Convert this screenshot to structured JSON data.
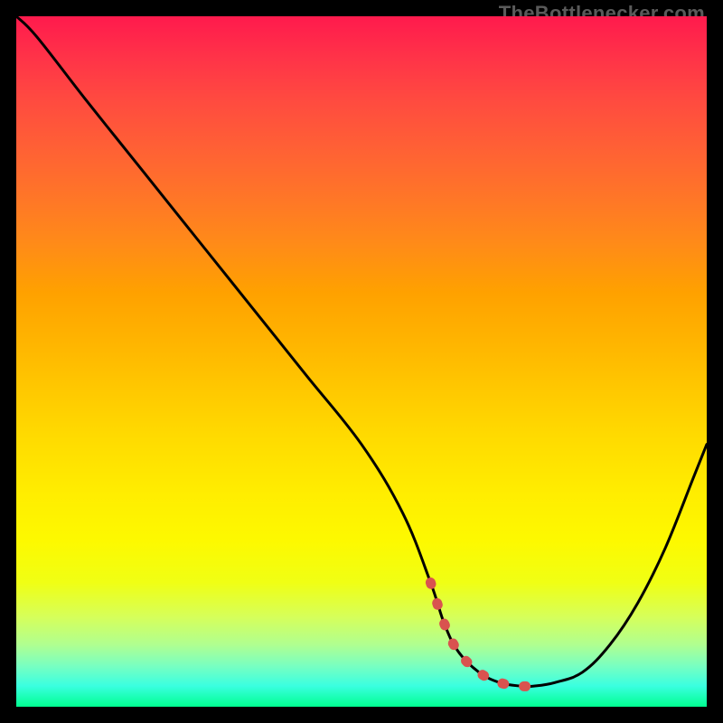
{
  "watermark": "TheBottleneсker.com",
  "chart_data": {
    "type": "line",
    "title": "",
    "xlabel": "",
    "ylabel": "",
    "xlim": [
      0,
      100
    ],
    "ylim": [
      0,
      100
    ],
    "x": [
      0,
      3,
      10,
      18,
      26,
      34,
      42,
      50,
      56,
      60,
      62,
      64,
      67,
      70,
      73,
      75,
      78,
      82,
      86,
      90,
      94,
      98,
      100
    ],
    "values": [
      100,
      97,
      88,
      78,
      68,
      58,
      48,
      38,
      28,
      18,
      12,
      8,
      5,
      3.5,
      3,
      3,
      3.5,
      5,
      9,
      15,
      23,
      33,
      38
    ],
    "marker": {
      "enabled": true,
      "segment": {
        "x_pct_range": [
          58,
          76
        ],
        "y_pct_min": 3,
        "style": "thick-red-dotted"
      }
    },
    "background_gradient": {
      "direction": "vertical",
      "stops": [
        {
          "pos": 0,
          "color": "#ff1a4d"
        },
        {
          "pos": 40,
          "color": "#ffa100"
        },
        {
          "pos": 76,
          "color": "#fdf900"
        },
        {
          "pos": 100,
          "color": "#00ff90"
        }
      ]
    }
  }
}
